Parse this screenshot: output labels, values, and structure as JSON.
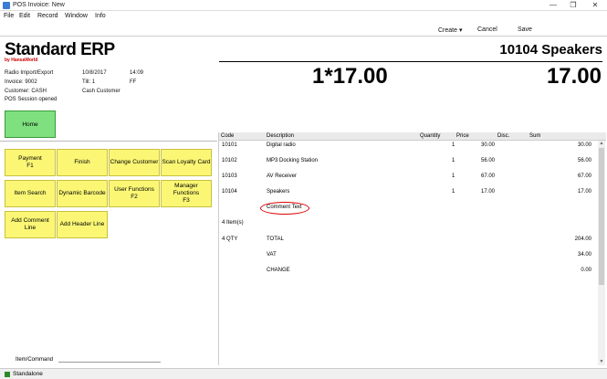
{
  "window": {
    "title": "POS Invoice: New",
    "minimize": "—",
    "restore": "❐",
    "close": "✕"
  },
  "menu": [
    "File",
    "Edit",
    "Record",
    "Window",
    "Info"
  ],
  "toolbar": {
    "create": "Create",
    "cancel": "Cancel",
    "save": "Save"
  },
  "brand": {
    "name": "Standard ERP",
    "sub": "by HansaWorld"
  },
  "info": {
    "lines": [
      "Radio Import/Export",
      "Invoice: 9002",
      "Customer: CASH",
      "POS Session opened"
    ],
    "date": "10/8/2017",
    "time": "14:09",
    "till": "Till: 1",
    "ff": "FF",
    "customer_name": "Cash Customer"
  },
  "display": {
    "customer": "10104 Speakers",
    "qty_price": "1*17.00",
    "total": "17.00"
  },
  "home_label": "Home",
  "function_buttons": [
    "Payment\nF1",
    "Finish",
    "Change Customer",
    "Scan Loyalty Card",
    "Item Search",
    "Dynamic Barcode",
    "User Functions\nF2",
    "Manager\nFunctions\nF3",
    "Add Comment\nLine",
    "Add Header Line"
  ],
  "command_label": "Item/Command",
  "grid": {
    "headers": [
      "Code",
      "Description",
      "Quantity",
      "Price",
      "Disc.",
      "Sum"
    ],
    "rows": [
      {
        "code": "10101",
        "desc": "Digital radio",
        "qty": "1",
        "price": "30.00",
        "sum": "30.00"
      },
      {
        "code": "10102",
        "desc": "MP3 Docking Station",
        "qty": "1",
        "price": "56.00",
        "sum": "56.00"
      },
      {
        "code": "10103",
        "desc": "AV Receiver",
        "qty": "1",
        "price": "67.00",
        "sum": "67.00"
      },
      {
        "code": "10104",
        "desc": "Speakers",
        "qty": "1",
        "price": "17.00",
        "sum": "17.00"
      }
    ],
    "comment": "Comment Text",
    "items_count": "4 Item(s)",
    "qty_total": "4 QTY",
    "total_label": "TOTAL",
    "total_value": "204.00",
    "vat_label": "VAT",
    "vat_value": "34.00",
    "change_label": "CHANGE",
    "change_value": "0.00"
  },
  "status": "Standalone",
  "colors": {
    "home_green": "#7ee07e",
    "function_yellow": "#fbf775",
    "annotation_red": "#dd0000"
  }
}
